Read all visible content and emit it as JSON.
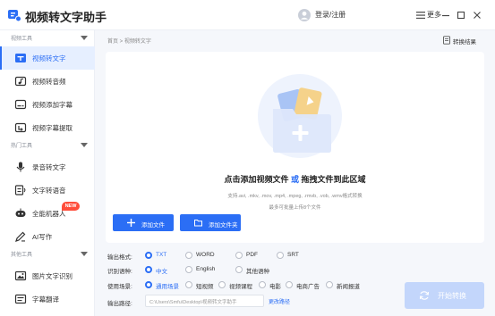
{
  "app": {
    "title": "视频转文字助手"
  },
  "titlebar": {
    "login_label": "登录/注册",
    "more_label": "更多"
  },
  "sidebar": {
    "sections": [
      {
        "title": "视频工具",
        "items": [
          {
            "label": "视频转文字",
            "icon": "video-text-icon",
            "active": true
          },
          {
            "label": "视频转音频",
            "icon": "video-audio-icon"
          },
          {
            "label": "视频添加字幕",
            "icon": "subtitle-add-icon"
          },
          {
            "label": "视频字幕提取",
            "icon": "subtitle-extract-icon"
          }
        ]
      },
      {
        "title": "热门工具",
        "items": [
          {
            "label": "录音转文字",
            "icon": "microphone-icon"
          },
          {
            "label": "文字转语音",
            "icon": "text-speech-icon"
          },
          {
            "label": "全能机器人",
            "icon": "robot-icon",
            "badge": "NEW"
          },
          {
            "label": "AI写作",
            "icon": "ai-write-icon"
          }
        ]
      },
      {
        "title": "其他工具",
        "items": [
          {
            "label": "图片文字识别",
            "icon": "image-ocr-icon"
          },
          {
            "label": "字幕翻译",
            "icon": "translate-icon"
          }
        ]
      }
    ]
  },
  "main": {
    "breadcrumb": "首页 > 视频转文字",
    "convert_result_label": "转换结果",
    "drop": {
      "prompt_pre": "点击添加视频文件",
      "prompt_or": "或",
      "prompt_post": "拖拽文件到此区域",
      "formats": "支持.avi, .mkv, .mov, .mp4, .mpeg, .rmvb, .vob, .wmv格式转换",
      "limit": "最多可批量上传8个文件"
    },
    "add_file_label": "添加文件",
    "add_folder_label": "添加文件夹"
  },
  "settings": {
    "format": {
      "label": "输出格式:",
      "options": [
        "TXT",
        "WORD",
        "PDF",
        "SRT"
      ],
      "selected": 0
    },
    "language": {
      "label": "识别语种:",
      "options": [
        "中文",
        "English",
        "其他语种"
      ],
      "selected": 0
    },
    "scene": {
      "label": "使用场景:",
      "options": [
        "通用场景",
        "短视频",
        "视频课程",
        "电影",
        "电商广告",
        "新闻报道"
      ],
      "selected": 0
    },
    "output_path": {
      "label": "输出路径:",
      "value": "C:\\Users\\Smfu\\Desktop\\视频转文字助手",
      "change_label": "更改路径"
    }
  },
  "start_button_label": "开始转换",
  "colors": {
    "accent": "#2b6ef5",
    "active_bg": "#e6efff",
    "disabled_btn": "#c3d6fb",
    "badge": "#ff4d3a"
  }
}
